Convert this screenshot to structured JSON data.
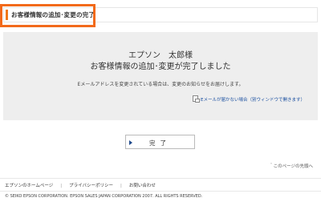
{
  "header": {
    "title": "お客様情報の追加･変更の完了"
  },
  "colors": {
    "highlight": "#f26a1b",
    "link": "#1a4fa0",
    "panel": "#eeeeee"
  },
  "panel": {
    "customer_name": "エプソン　太郎様",
    "heading": "お客様情報の追加･変更が完了しました",
    "notice": "Eメールアドレスを変更されている場合は、変更のお知らせをお届けします。",
    "help_link": "Eメールが届かない場合（別ウィンドウで開きます）",
    "help_icon": "new-window-icon"
  },
  "done_button": {
    "label": "完了"
  },
  "page_top_link": "＾このページの先頭へ",
  "footer": {
    "links": [
      "エプソンのホームページ",
      "プライバシーポリシー",
      "お問い合わせ"
    ],
    "separator": "|",
    "copyright": "© SEIKO EPSON CORPORATION. EPSON SALES JAPAN CORPORATION 2007. ALL RIGHTS RESERVED."
  }
}
